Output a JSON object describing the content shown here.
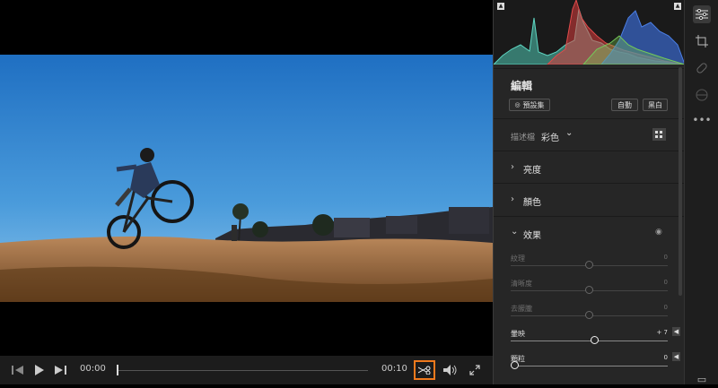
{
  "player": {
    "current_time": "00:00",
    "total_time": "00:10",
    "playhead_fraction": 0.0,
    "scrub_fraction": 0.5
  },
  "edit": {
    "heading": "編輯",
    "preset_label": "預設集",
    "auto_label": "自動",
    "bw_label": "黑白",
    "profile_label": "描述檔",
    "profile_value": "彩色",
    "sections": {
      "light": "亮度",
      "color": "顏色",
      "effects": "效果"
    },
    "sliders": [
      {
        "label": "紋理",
        "value": "0",
        "level": 0.5,
        "enabled": false
      },
      {
        "label": "清晰度",
        "value": "0",
        "level": 0.5,
        "enabled": false
      },
      {
        "label": "去朦朧",
        "value": "0",
        "level": 0.5,
        "enabled": false
      },
      {
        "label": "暈映",
        "value": "+ 7",
        "level": 0.535,
        "enabled": true
      },
      {
        "label": "顆粒",
        "value": "0",
        "level": 0.0,
        "enabled": true
      }
    ]
  },
  "colors": {
    "accent_orange": "#f07a1d",
    "panel_bg": "#262626"
  },
  "icons": {
    "rail": [
      "sliders-icon",
      "crop-icon",
      "healing-icon",
      "mask-icon",
      "more-icon",
      "comment-icon"
    ]
  }
}
